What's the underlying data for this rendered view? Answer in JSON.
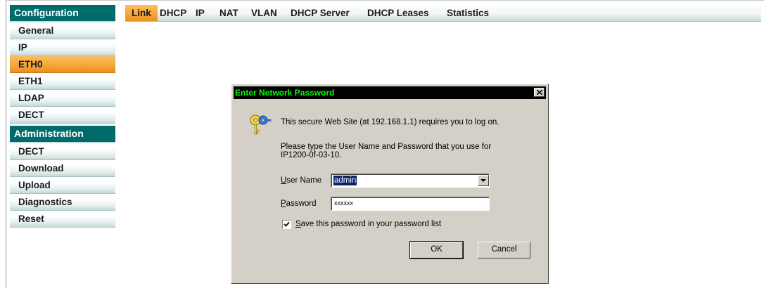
{
  "sidebar": {
    "configuration": {
      "title": "Configuration",
      "items": [
        "General",
        "IP",
        "ETH0",
        "ETH1",
        "LDAP",
        "DECT"
      ],
      "active": "ETH0"
    },
    "administration": {
      "title": "Administration",
      "items": [
        "DECT",
        "Download",
        "Upload",
        "Diagnostics",
        "Reset"
      ]
    }
  },
  "tabs": {
    "items": [
      "Link",
      "DHCP",
      "IP",
      "NAT",
      "VLAN",
      "DHCP Server",
      "DHCP Leases",
      "Statistics"
    ],
    "active": "Link"
  },
  "dialog": {
    "title": "Enter Network Password",
    "close_glyph": "×",
    "message": "This secure Web Site (at 192.168.1.1) requires you to log on.",
    "instruction_line1": "Please type the User Name and Password that you use for",
    "instruction_line2": "IP1200-0f-03-10.",
    "username_label_u": "U",
    "username_label_rest": "ser Name",
    "username_value": "admin",
    "password_label_u": "P",
    "password_label_rest": "assword",
    "password_value": "xxxxxx",
    "save_label_u": "S",
    "save_label_rest": "ave this password in your password list",
    "save_checked": true,
    "ok_label": "OK",
    "cancel_label": "Cancel"
  },
  "colors": {
    "header_teal": "#006b6b",
    "active_orange": "#f4a63a",
    "dialog_title_text": "#00ff00",
    "dialog_face": "#d4d0c8"
  }
}
